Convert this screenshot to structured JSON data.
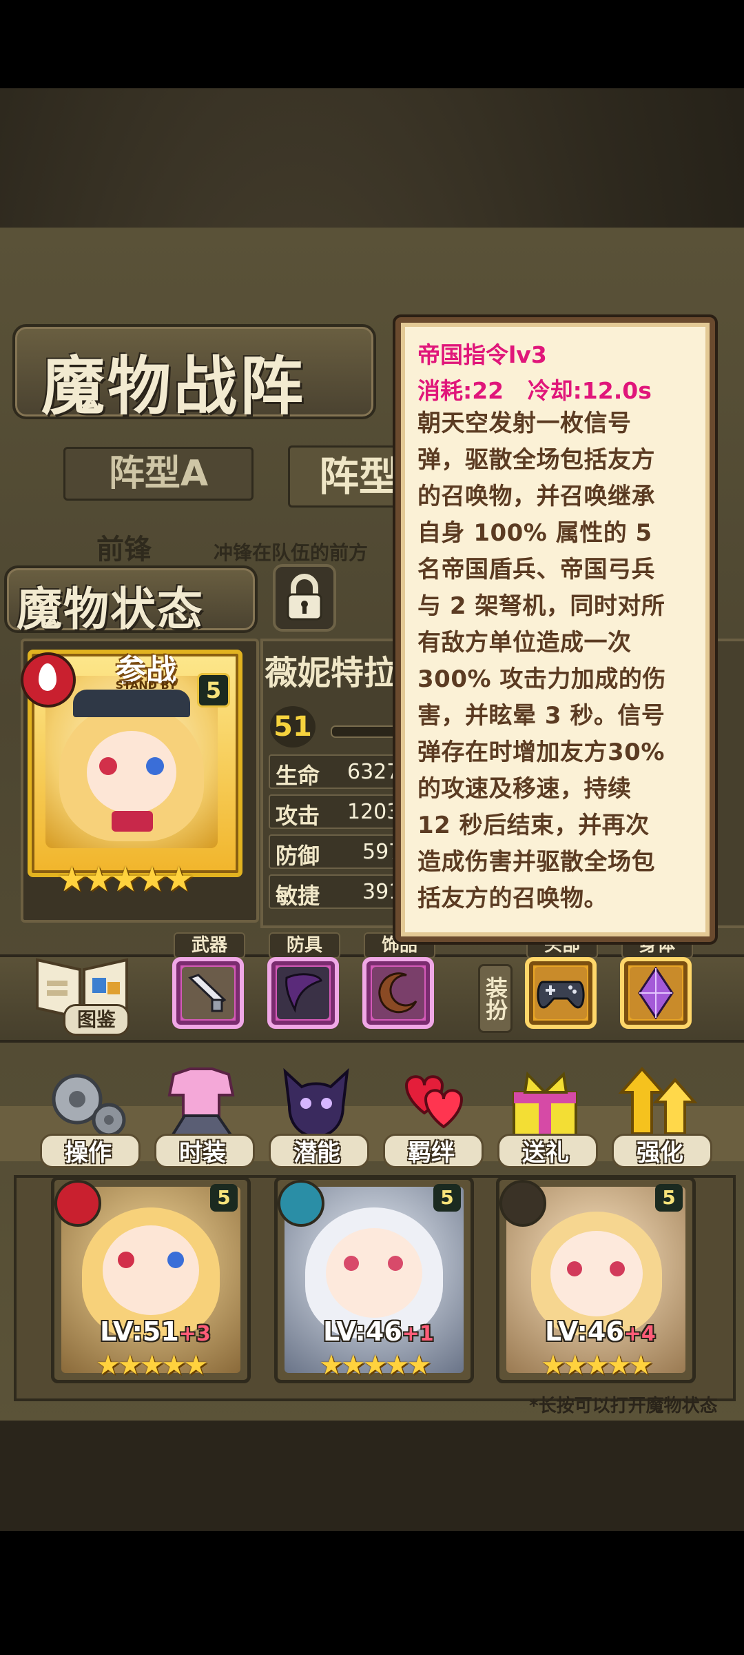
{
  "titles": {
    "formation": "魔物战阵",
    "status": "魔物状态"
  },
  "tabs": [
    {
      "label": "阵型A"
    },
    {
      "label": "阵型"
    }
  ],
  "vanguard": {
    "label": "前锋",
    "desc": "冲锋在队伍的前方"
  },
  "character": {
    "name": "薇妮特拉",
    "badge": "参战",
    "badge_sub": "STAND BY",
    "rank": "5",
    "level": "51",
    "stars": "★★★★★",
    "stats": [
      {
        "label": "生命",
        "value": "6327"
      },
      {
        "label": "攻击",
        "value": "1203"
      },
      {
        "label": "防御",
        "value": "597"
      },
      {
        "label": "敏捷",
        "value": "391"
      }
    ]
  },
  "equipment": {
    "codex": "图鉴",
    "dress_up": "装扮",
    "slots": [
      {
        "label": "武器",
        "icon": "gun-icon"
      },
      {
        "label": "防具",
        "icon": "feather-cape-icon"
      },
      {
        "label": "饰品",
        "icon": "moon-icon"
      },
      {
        "label": "头部",
        "icon": "gamepad-icon"
      },
      {
        "label": "身体",
        "icon": "purple-crystal-icon"
      }
    ]
  },
  "actions": [
    {
      "label": "操作",
      "icon": "gear-icon"
    },
    {
      "label": "时装",
      "icon": "outfit-icon"
    },
    {
      "label": "潜能",
      "icon": "shadow-demon-icon"
    },
    {
      "label": "羁绊",
      "icon": "hearts-icon"
    },
    {
      "label": "送礼",
      "icon": "gift-icon"
    },
    {
      "label": "强化",
      "icon": "upgrade-arrows-icon"
    }
  ],
  "roster": [
    {
      "level": "LV:51",
      "plus": "+3",
      "rank": "5",
      "stars": "★★★★★",
      "element": "fire"
    },
    {
      "level": "LV:46",
      "plus": "+1",
      "rank": "5",
      "stars": "★★★★★",
      "element": "water"
    },
    {
      "level": "LV:46",
      "plus": "+4",
      "rank": "5",
      "stars": "★★★★★",
      "element": "earth"
    }
  ],
  "hint": "*长按可以打开魔物状态",
  "tooltip": {
    "title": "帝国指令lv3",
    "cost": "消耗:22   冷却:12.0s",
    "desc_lines": [
      "朝天空发射一枚信号",
      "弹，驱散全场包括友方",
      "的召唤物，并召唤继承",
      "自身 100% 属性的 5",
      "名帝国盾兵、帝国弓兵",
      "与 2 架弩机，同时对所",
      "有敌方单位造成一次",
      "300% 攻击力加成的伤",
      "害，并眩晕 3 秒。信号",
      "弹存在时增加友方30%",
      "的攻速及移速，持续",
      "12 秒后结束，并再次",
      "造成伤害并驱散全场包",
      "括友方的召唤物。"
    ]
  }
}
